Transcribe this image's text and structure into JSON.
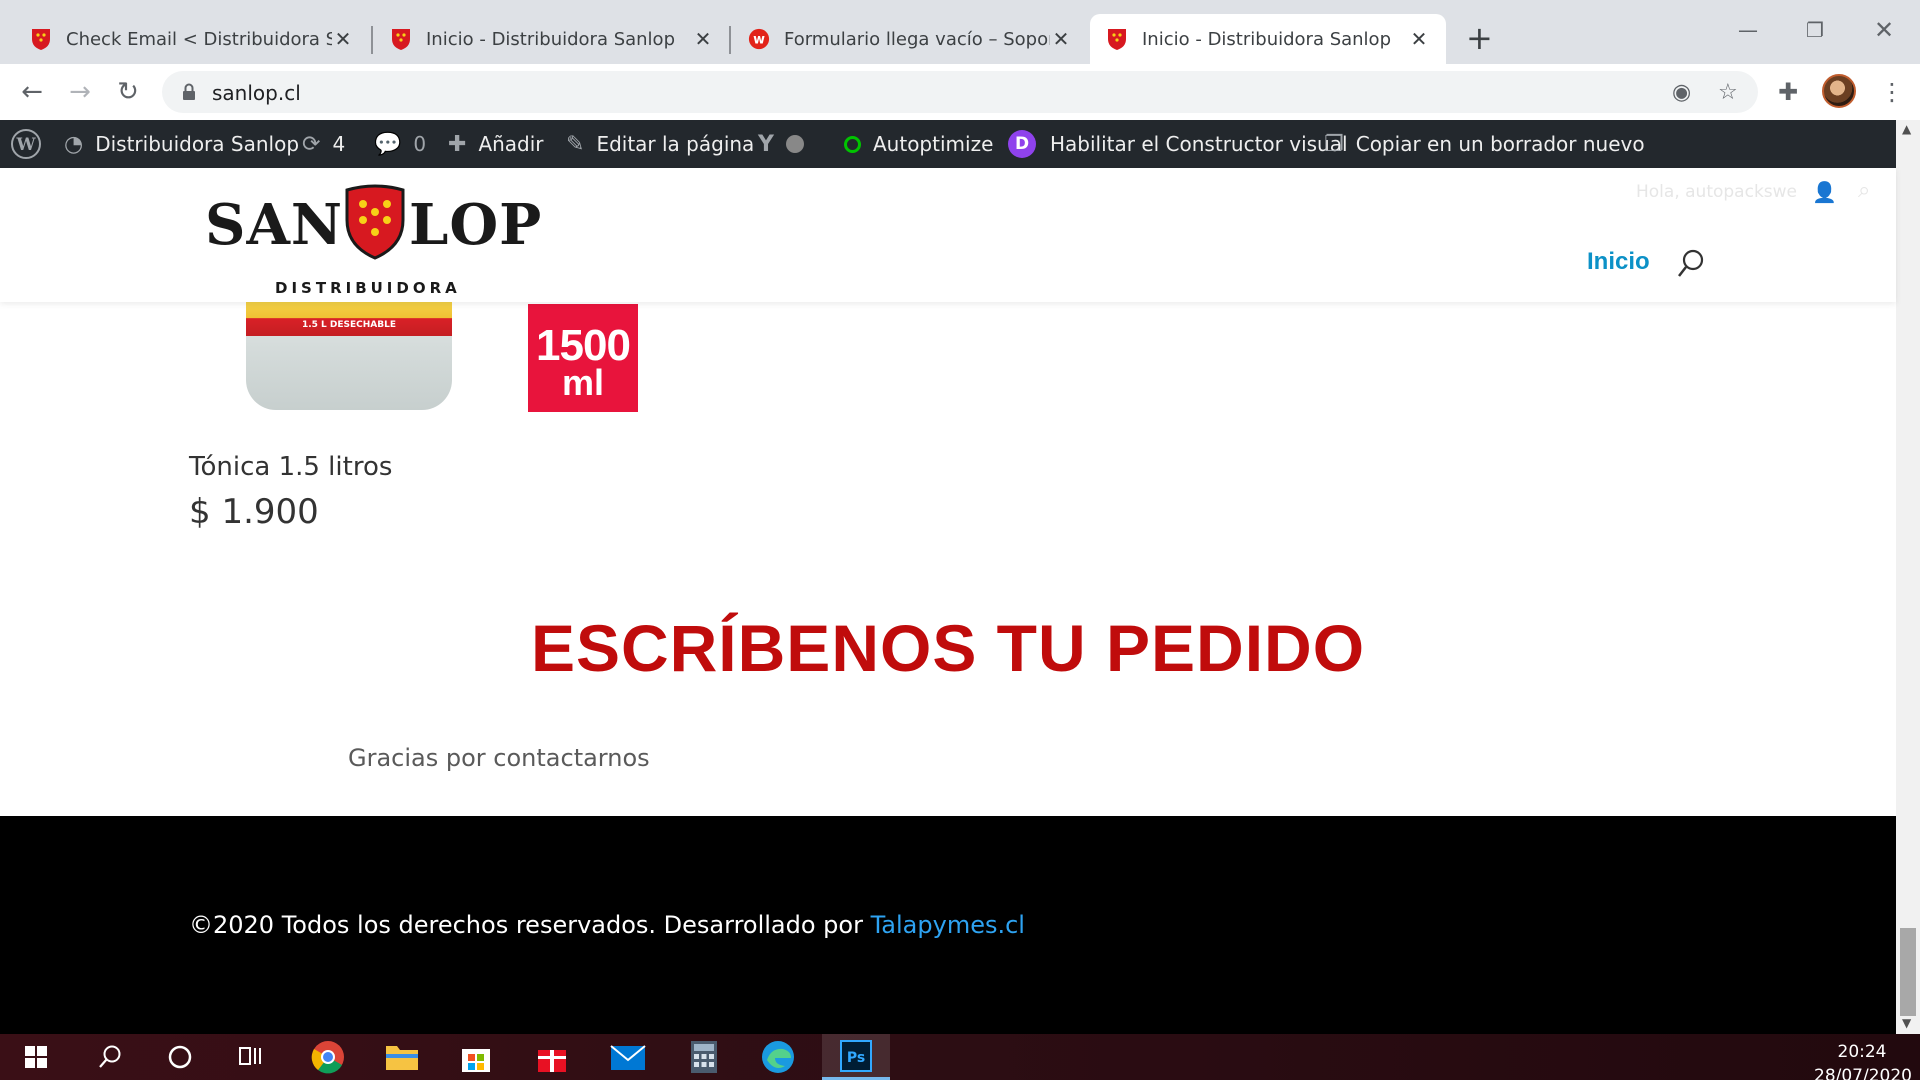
{
  "browser": {
    "tabs": [
      {
        "title": "Check Email < Distribuidora Sanlop",
        "favicon": "sanlop-shield-icon",
        "active": false
      },
      {
        "title": "Inicio - Distribuidora Sanlop",
        "favicon": "sanlop-shield-icon",
        "active": false
      },
      {
        "title": "Formulario llega vacío – Soporte",
        "favicon": "wpforms-icon",
        "active": false
      },
      {
        "title": "Inicio - Distribuidora Sanlop",
        "favicon": "sanlop-shield-icon",
        "active": true
      }
    ],
    "url": "sanlop.cl"
  },
  "adminbar": {
    "site_name": "Distribuidora Sanlop",
    "updates_count": "4",
    "comments_count": "0",
    "add_label": "Añadir",
    "edit_label": "Editar la página",
    "autoptimize_label": "Autoptimize",
    "visual_builder_label": "Habilitar el Constructor visual",
    "duplicate_label": "Copiar en un borrador nuevo"
  },
  "site": {
    "logo_left": "SAN",
    "logo_right": "LOP",
    "logo_sub": "DISTRIBUIDORA",
    "greeting": "Hola, autopackswe",
    "menu": [
      {
        "label": "Inicio"
      }
    ]
  },
  "product": {
    "name": "Tónica 1.5 litros",
    "price": "$ 1.900",
    "label_text": "1.5 L   DESECHABLE",
    "badge_number": "1500",
    "badge_unit": "ml"
  },
  "order_section": {
    "heading": "ESCRÍBENOS TU PEDIDO",
    "message": "Gracias por contactarnos"
  },
  "footer": {
    "text": "©2020 Todos los derechos reservados. Desarrollado por ",
    "link_text": "Talapymes.cl"
  },
  "taskbar": {
    "time": "20:24",
    "date": "28/07/2020"
  },
  "colors": {
    "brand_red": "#c00c0c",
    "link_blue": "#2ea3f2",
    "menu_blue": "#0c91c7",
    "adminbar_bg": "#23282d"
  }
}
